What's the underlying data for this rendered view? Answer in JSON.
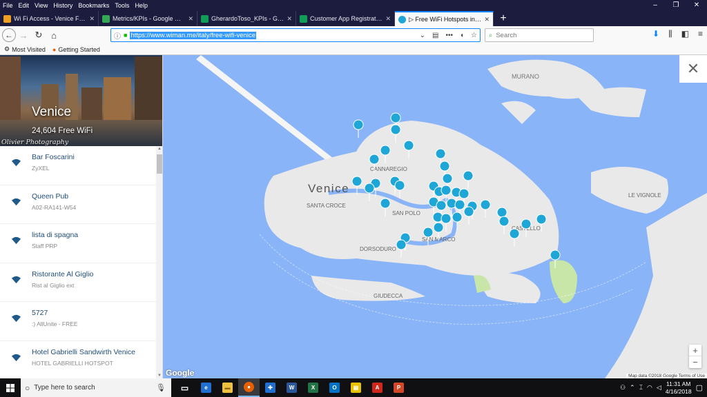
{
  "menu": [
    "File",
    "Edit",
    "View",
    "History",
    "Bookmarks",
    "Tools",
    "Help"
  ],
  "window_controls": [
    "–",
    "❐",
    "✕"
  ],
  "tabs": [
    {
      "title": "Wi Fi Access - Venice Forum - T",
      "icon_color": "#f0a020",
      "active": false
    },
    {
      "title": "Metrics/KPIs - Google Drive",
      "icon_color": "#34a853",
      "active": false
    },
    {
      "title": "GherardoToso_KPIs - Google Sh",
      "icon_color": "#0f9d58",
      "active": false
    },
    {
      "title": "Customer App Registrations - G",
      "icon_color": "#0f9d58",
      "active": false
    },
    {
      "title": "▷ Free WiFi Hotspots in Venice",
      "icon_color": "#1ea7d6",
      "active": true
    }
  ],
  "newtab_label": "+",
  "tab_close": "✕",
  "navbar": {
    "url": "https://www.wiman.me/italy/free-wifi-venice",
    "search_placeholder": "Search",
    "back": "←",
    "forward": "→",
    "reload": "↻",
    "home": "⌂",
    "url_menu": "•••",
    "info_icon": "ⓘ",
    "lock_icon": "🔒"
  },
  "bookmarks": [
    {
      "label": "Most Visited",
      "icon": "gear-icon"
    },
    {
      "label": "Getting Started",
      "icon": "firefox-icon"
    }
  ],
  "sidebar": {
    "city": "Venice",
    "wifi_count": "24,604 Free WiFi",
    "photo_credit": "Olivier Photography",
    "hotspots": [
      {
        "name": "Bar Foscarini",
        "network": "ZyXEL"
      },
      {
        "name": "Queen Pub",
        "network": "A02-RA141-W54"
      },
      {
        "name": "lista di spagna",
        "network": "Staff PRP"
      },
      {
        "name": "Ristorante Al Giglio",
        "network": "Rist al Giglio ext"
      },
      {
        "name": "5727",
        "network": ":) AllUnite - FREE"
      },
      {
        "name": "Hotel Gabrielli Sandwirth Venice",
        "network": "HOTEL GABRIELLI HOTSPOT"
      }
    ]
  },
  "map": {
    "labels": {
      "murano": "MURANO",
      "venice": "Venice",
      "santa_croce": "SANTA CROCE",
      "cannaregio": "CANNAREGIO",
      "san_polo": "SAN POLO",
      "dorsoduro": "DORSODURO",
      "san_marco": "SAN MARCO",
      "castello": "CASTELLO",
      "giudecca": "GIUDECCA",
      "le_vignole": "LE VIGNOLE"
    },
    "close": "✕",
    "zoom_in": "+",
    "zoom_out": "−",
    "google": "Google",
    "attribution": "Map data ©2018 Google   Terms of Use",
    "pin_color": "#1ea7d6",
    "water_color": "#8ab4f8",
    "land_color": "#e9e9e9"
  },
  "taskbar": {
    "search_placeholder": "Type here to search",
    "time": "11:31 AM",
    "date": "4/16/2018",
    "apps": [
      {
        "name": "task-view",
        "color": "#333",
        "label": "▭"
      },
      {
        "name": "edge",
        "color": "#1e6fd0",
        "label": "e"
      },
      {
        "name": "file-explorer",
        "color": "#f0c040",
        "label": "▬"
      },
      {
        "name": "firefox",
        "color": "#e66000",
        "label": "●"
      },
      {
        "name": "security",
        "color": "#1e6fd0",
        "label": "✚"
      },
      {
        "name": "word",
        "color": "#2b579a",
        "label": "W"
      },
      {
        "name": "excel",
        "color": "#217346",
        "label": "X"
      },
      {
        "name": "outlook",
        "color": "#0072c6",
        "label": "O"
      },
      {
        "name": "sticky-notes",
        "color": "#e6c200",
        "label": "▤"
      },
      {
        "name": "acrobat",
        "color": "#d0271d",
        "label": "A"
      },
      {
        "name": "powerpoint",
        "color": "#d24726",
        "label": "P"
      }
    ]
  }
}
